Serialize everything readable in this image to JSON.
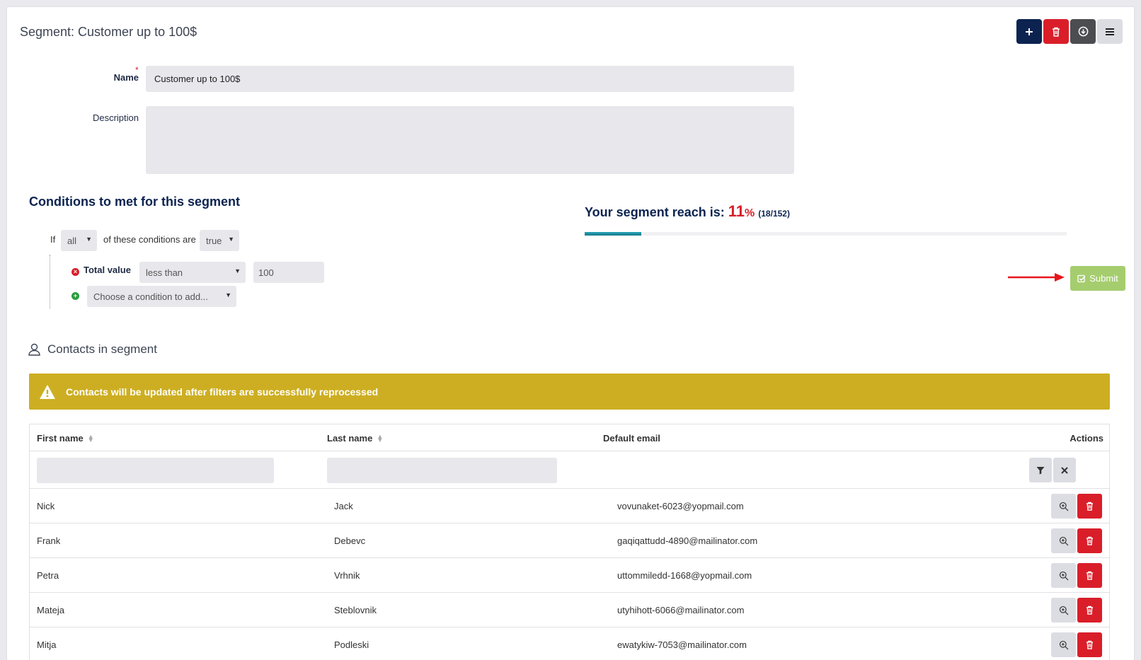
{
  "header": {
    "title": "Segment: Customer up to 100$"
  },
  "toolbar": {
    "add_icon": "plus-icon",
    "delete_icon": "trash-icon",
    "download_icon": "download-circle-icon",
    "menu_icon": "hamburger-icon"
  },
  "form": {
    "name_label": "Name",
    "required_mark": "*",
    "name_value": "Customer up to 100$",
    "description_label": "Description",
    "description_value": ""
  },
  "conditions": {
    "heading": "Conditions to met for this segment",
    "if_text": "If",
    "match_value": "all",
    "of_these_text": "of these conditions are",
    "truth_value": "true",
    "rows": [
      {
        "label": "Total value",
        "operator": "less than",
        "value": "100"
      }
    ],
    "add_placeholder": "Choose a condition to add..."
  },
  "reach": {
    "label": "Your segment reach is:",
    "percent": "11",
    "percent_sign": "%",
    "count": "(18/152)",
    "fraction": 0.118
  },
  "submit": {
    "label": "Submit"
  },
  "contacts": {
    "heading": "Contacts in segment",
    "alert": "Contacts will be updated after filters are successfully reprocessed",
    "columns": {
      "first": "First name",
      "last": "Last name",
      "email": "Default email",
      "actions": "Actions"
    },
    "rows": [
      {
        "first": "Nick",
        "last": "Jack",
        "email": "vovunaket-6023@yopmail.com"
      },
      {
        "first": "Frank",
        "last": "Debevc",
        "email": "gaqiqattudd-4890@mailinator.com"
      },
      {
        "first": "Petra",
        "last": "Vrhnik",
        "email": "uttommiledd-1668@yopmail.com"
      },
      {
        "first": "Mateja",
        "last": "Steblovnik",
        "email": "utyhihott-6066@mailinator.com"
      },
      {
        "first": "Mitja",
        "last": "Podleski",
        "email": "ewatykiw-7053@mailinator.com"
      }
    ]
  },
  "colors": {
    "navy": "#0c2350",
    "danger": "#d91e2a",
    "success": "#a5cd6e",
    "warning": "#cdae22",
    "progress": "#25a3b6"
  }
}
